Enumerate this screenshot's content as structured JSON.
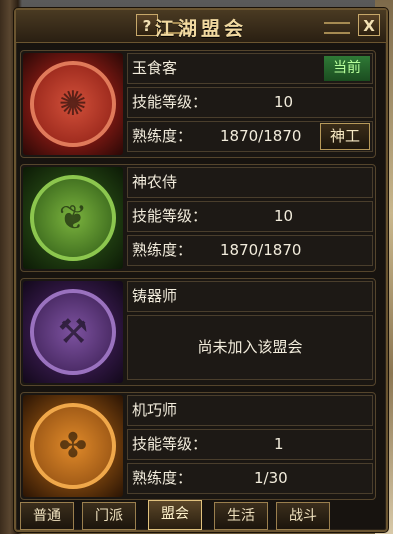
{
  "window": {
    "title": "江湖盟会",
    "help_label": "?",
    "close_label": "X"
  },
  "guilds": [
    {
      "name": "玉食客",
      "status": "当前",
      "skill_label": "技能等级：",
      "skill_value": "10",
      "prof_label": "熟练度：",
      "prof_value": "1870/1870",
      "action": "神工",
      "color": "#a8241c"
    },
    {
      "name": "神农侍",
      "skill_label": "技能等级：",
      "skill_value": "10",
      "prof_label": "熟练度：",
      "prof_value": "1870/1870",
      "color": "#3f7a1e"
    },
    {
      "name": "铸器师",
      "message": "尚未加入该盟会",
      "color": "#5a2c7a"
    },
    {
      "name": "机巧师",
      "skill_label": "技能等级：",
      "skill_value": "1",
      "prof_label": "熟练度：",
      "prof_value": "1/30",
      "color": "#b8681a"
    }
  ],
  "tabs": [
    {
      "label": "普通"
    },
    {
      "label": "门派"
    },
    {
      "label": "盟会",
      "active": true
    },
    {
      "label": "生活"
    },
    {
      "label": "战斗"
    }
  ]
}
